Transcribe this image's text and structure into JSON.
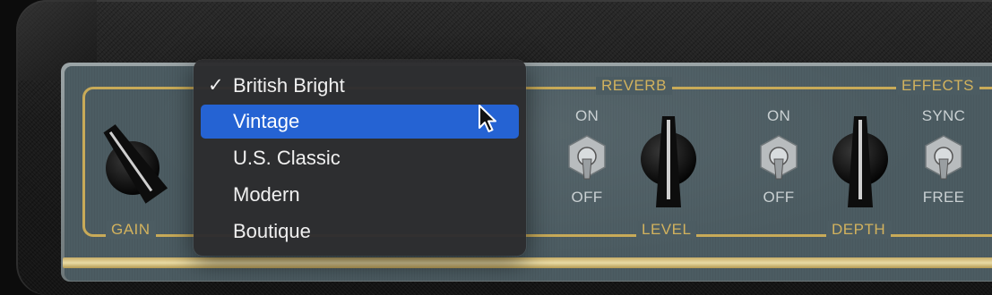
{
  "amp": {
    "controls": {
      "gain_label": "GAIN",
      "reverb_section_label": "REVERB",
      "effects_section_label": "EFFECTS",
      "level_label": "LEVEL",
      "depth_label": "DEPTH",
      "reverb_on_label": "ON",
      "reverb_off_label": "OFF",
      "effects_on_label": "ON",
      "effects_off_label": "OFF",
      "sync_label": "SYNC",
      "free_label": "FREE"
    },
    "colors": {
      "panel": "#4c5c62",
      "gold_trim": "#c8aa58",
      "menu_highlight": "#2563d3"
    }
  },
  "model_menu": {
    "items": [
      {
        "label": "British Bright",
        "checked": true,
        "highlighted": false
      },
      {
        "label": "Vintage",
        "checked": false,
        "highlighted": true
      },
      {
        "label": "U.S. Classic",
        "checked": false,
        "highlighted": false
      },
      {
        "label": "Modern",
        "checked": false,
        "highlighted": false
      },
      {
        "label": "Boutique",
        "checked": false,
        "highlighted": false
      }
    ],
    "check_glyph": "✓"
  }
}
